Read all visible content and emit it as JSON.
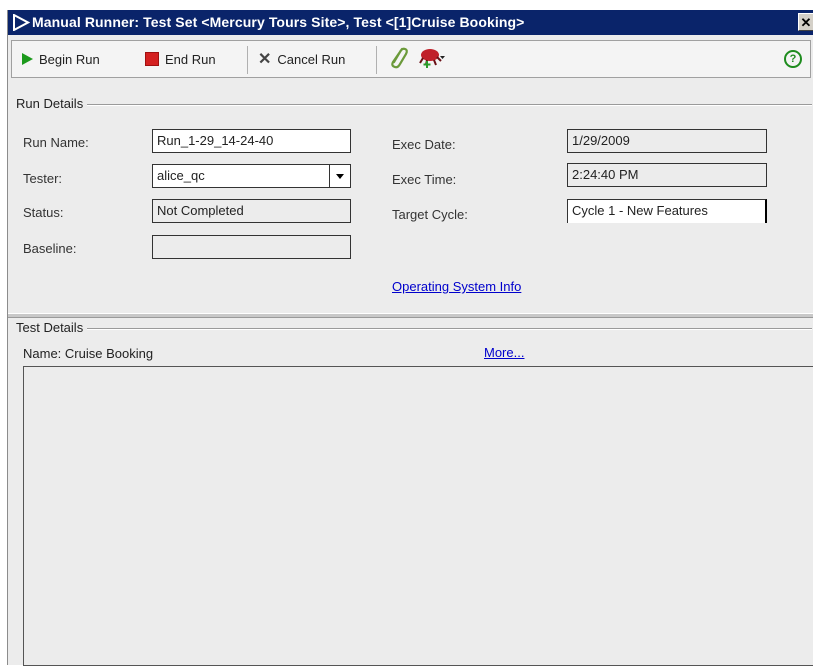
{
  "window": {
    "title": "Manual Runner: Test Set <Mercury Tours Site>, Test <[1]Cruise Booking>",
    "close_symbol": "✕"
  },
  "toolbar": {
    "begin_run": "Begin Run",
    "end_run": "End Run",
    "cancel_run": "Cancel Run",
    "attach_icon": "paperclip-icon",
    "defect_icon": "add-defect-icon",
    "help_symbol": "?"
  },
  "run_details": {
    "group_label": "Run Details",
    "run_name_label": "Run Name:",
    "run_name_value": "Run_1-29_14-24-40",
    "tester_label": "Tester:",
    "tester_value": "alice_qc",
    "status_label": "Status:",
    "status_value": "Not Completed",
    "baseline_label": "Baseline:",
    "baseline_value": "",
    "exec_date_label": "Exec Date:",
    "exec_date_value": "1/29/2009",
    "exec_time_label": "Exec Time:",
    "exec_time_value": "2:24:40 PM",
    "target_cycle_label": "Target Cycle:",
    "target_cycle_value": "Cycle 1 - New Features",
    "os_info_link": "Operating System Info"
  },
  "test_details": {
    "group_label": "Test Details",
    "name_text": "Name: Cruise Booking",
    "more_link": "More..."
  },
  "colors": {
    "title_bar": "#0a246a",
    "window_bg": "#ececec",
    "link": "#0000cc",
    "begin_icon": "#1c9a1c",
    "end_icon": "#d42020"
  }
}
